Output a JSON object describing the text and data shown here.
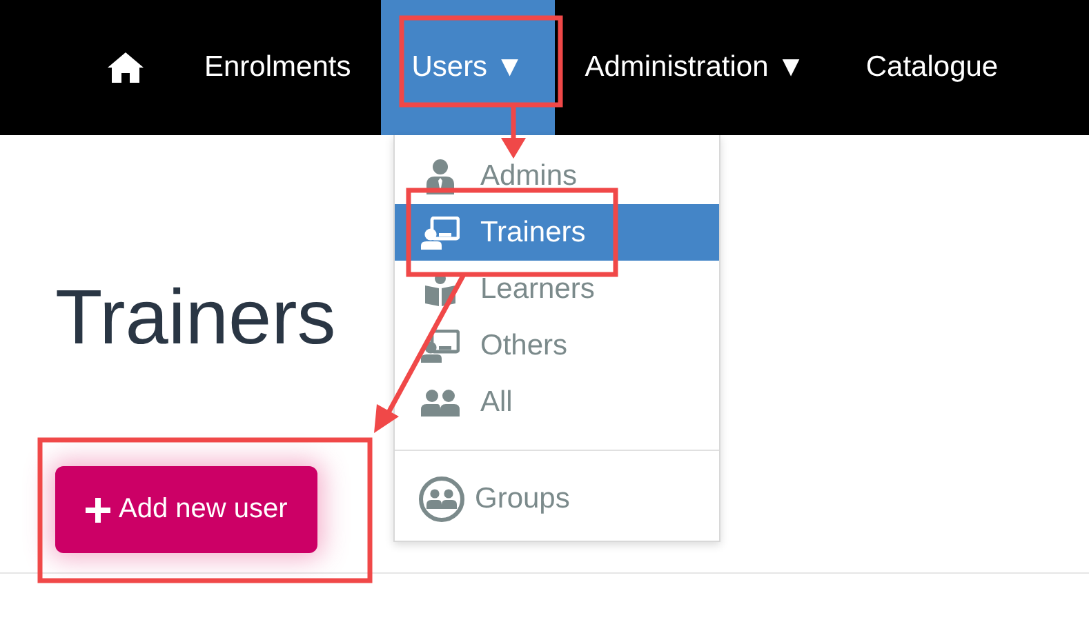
{
  "nav": {
    "items": [
      {
        "kind": "home",
        "selected": false
      },
      {
        "kind": "link",
        "label": "Enrolments",
        "selected": false
      },
      {
        "kind": "dropdown",
        "label": "Users",
        "caret": "▼",
        "selected": true
      },
      {
        "kind": "dropdown",
        "label": "Administration",
        "caret": "▼",
        "selected": false
      },
      {
        "kind": "link",
        "label": "Catalogue",
        "selected": false
      }
    ]
  },
  "users_menu": {
    "items": [
      {
        "label": "Admins",
        "selected": false
      },
      {
        "label": "Trainers",
        "selected": true
      },
      {
        "label": "Learners",
        "selected": false
      },
      {
        "label": "Others",
        "selected": false
      },
      {
        "label": "All",
        "selected": false
      }
    ],
    "footer_items": [
      {
        "label": "Groups",
        "selected": false
      }
    ]
  },
  "page": {
    "title": "Trainers",
    "add_button": {
      "label": "Add new user"
    }
  }
}
